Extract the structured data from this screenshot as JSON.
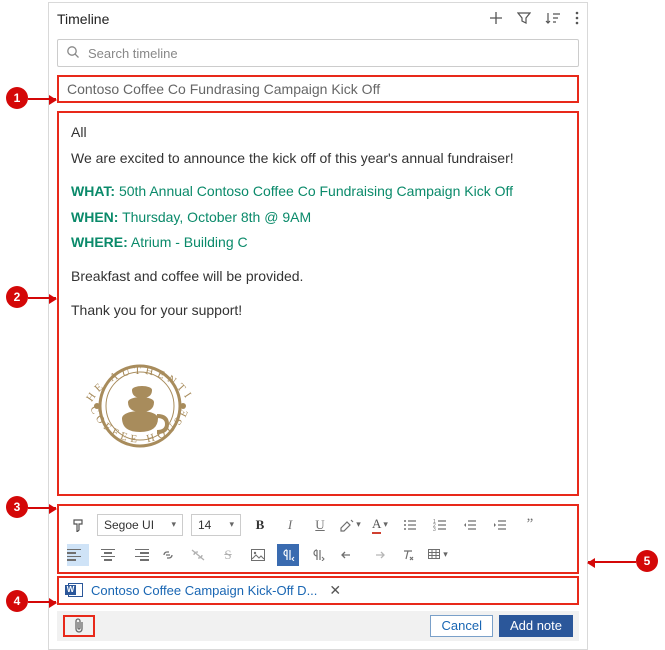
{
  "header": {
    "title": "Timeline"
  },
  "search": {
    "placeholder": "Search timeline"
  },
  "note": {
    "title": "Contoso Coffee Co Fundrasing Campaign Kick Off",
    "greeting": "All",
    "intro": "We are excited to announce the kick off of this year's annual fundraiser!",
    "what_label": "WHAT:",
    "what": "50th Annual Contoso Coffee Co Fundraising Campaign Kick Off",
    "when_label": "WHEN:",
    "when": "Thursday, October 8th @ 9AM",
    "where_label": "WHERE:",
    "where": "Atrium - Building C",
    "closing1": "Breakfast and coffee will be provided.",
    "closing2": "Thank you for your support!",
    "logo_top": "THE AUTHENTIC",
    "logo_bottom": "COFFEE HOUSE"
  },
  "toolbar": {
    "font": "Segoe UI",
    "size": "14"
  },
  "attachment": {
    "name": "Contoso Coffee Campaign Kick-Off D..."
  },
  "footer": {
    "cancel": "Cancel",
    "add": "Add note"
  },
  "callouts": {
    "1": "1",
    "2": "2",
    "3": "3",
    "4": "4",
    "5": "5"
  }
}
